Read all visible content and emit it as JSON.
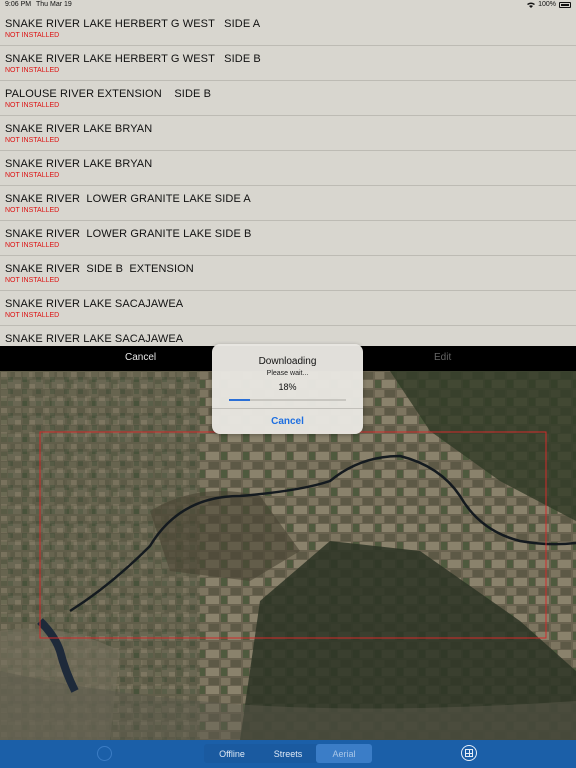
{
  "status_bar": {
    "time": "9:06 PM",
    "date": "Thu Mar 19",
    "battery": "100%"
  },
  "maps": [
    {
      "title": "SNAKE RIVER LAKE HERBERT G WEST   SIDE A",
      "status": "NOT INSTALLED"
    },
    {
      "title": "SNAKE RIVER LAKE HERBERT G WEST   SIDE B",
      "status": "NOT INSTALLED"
    },
    {
      "title": "PALOUSE RIVER EXTENSION    SIDE B",
      "status": "NOT INSTALLED"
    },
    {
      "title": "SNAKE RIVER LAKE BRYAN",
      "status": "NOT INSTALLED"
    },
    {
      "title": "SNAKE RIVER LAKE BRYAN",
      "status": "NOT INSTALLED"
    },
    {
      "title": "SNAKE RIVER  LOWER GRANITE LAKE SIDE A",
      "status": "NOT INSTALLED"
    },
    {
      "title": "SNAKE RIVER  LOWER GRANITE LAKE SIDE B",
      "status": "NOT INSTALLED"
    },
    {
      "title": "SNAKE RIVER  SIDE B  EXTENSION",
      "status": "NOT INSTALLED"
    },
    {
      "title": "SNAKE RIVER LAKE SACAJAWEA",
      "status": "NOT INSTALLED"
    },
    {
      "title": "SNAKE RIVER LAKE SACAJAWEA",
      "status": ""
    }
  ],
  "toolbar": {
    "cancel_label": "Cancel",
    "edit_label": "Edit"
  },
  "dialog": {
    "title": "Downloading",
    "message": "Please wait...",
    "percent_text": "18%",
    "progress": 0.18,
    "cancel_label": "Cancel",
    "accent_color": "#1e6fe0"
  },
  "bottom_bar": {
    "segments": [
      "Offline",
      "Streets",
      "Aerial"
    ],
    "selected": "Aerial",
    "left_icon": "layers-icon",
    "right_icon": "grid-icon",
    "color": "#1b5fa8"
  }
}
